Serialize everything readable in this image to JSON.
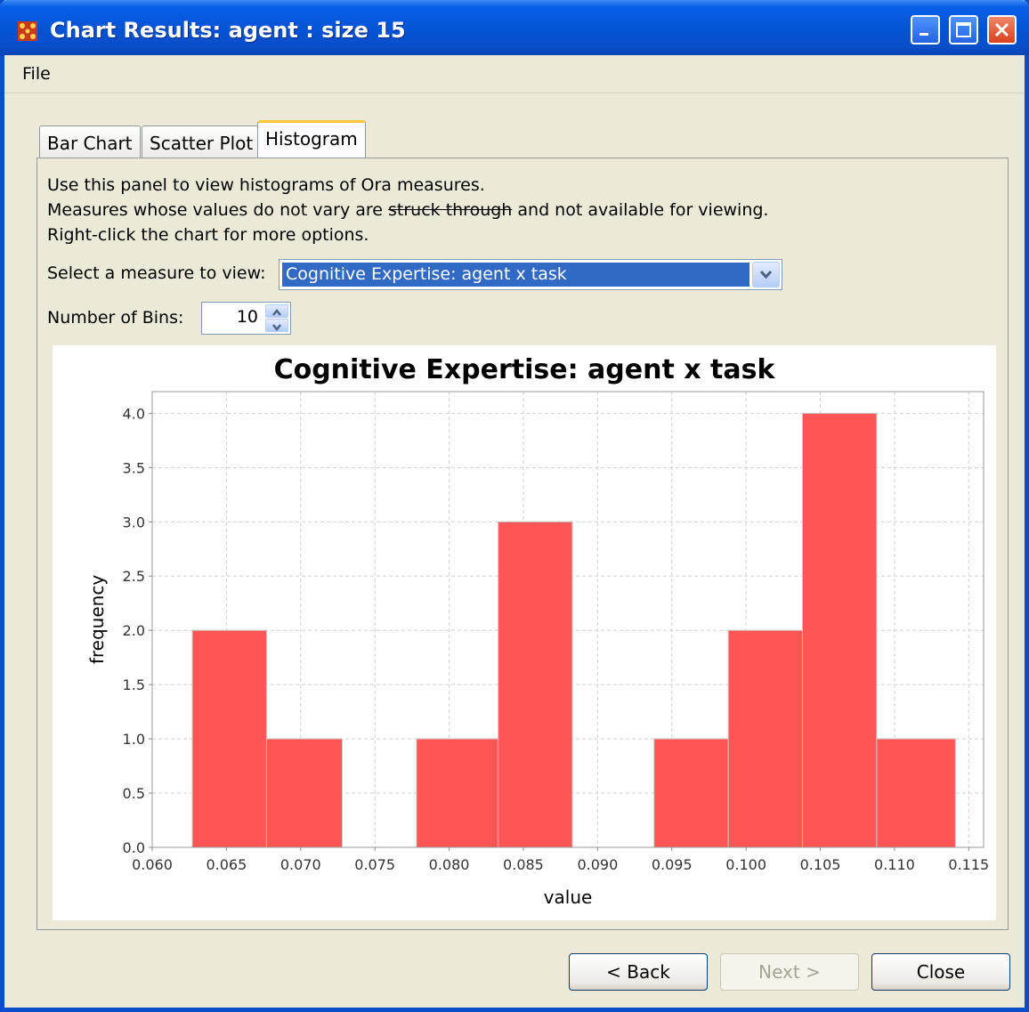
{
  "window": {
    "title": "Chart Results: agent : size 15",
    "menu_file": "File"
  },
  "tabs": [
    "Bar Chart",
    "Scatter Plot",
    "Histogram"
  ],
  "active_tab": "Histogram",
  "panel": {
    "line1": "Use this panel to view histograms of Ora measures.",
    "line2_pre": "Measures whose values do not vary are ",
    "line2_strike": "struck through",
    "line2_post": " and not available for viewing.",
    "line3": "Right-click the chart for more options.",
    "select_label": "Select a measure to view:",
    "select_value": "Cognitive Expertise: agent x task",
    "bins_label": "Number of Bins:",
    "bins_value": "10"
  },
  "buttons": {
    "back": "< Back",
    "next": "Next >",
    "close": "Close"
  },
  "colors": {
    "bar": "#ff5555",
    "accent": "#316ac5"
  },
  "chart_data": {
    "type": "bar",
    "title": "Cognitive Expertise: agent x task",
    "xlabel": "value",
    "ylabel": "frequency",
    "xlim": [
      0.06,
      0.116
    ],
    "ylim": [
      0,
      4.2
    ],
    "xticks": [
      "0.060",
      "0.065",
      "0.070",
      "0.075",
      "0.080",
      "0.085",
      "0.090",
      "0.095",
      "0.100",
      "0.105",
      "0.110",
      "0.115"
    ],
    "yticks": [
      "0.0",
      "0.5",
      "1.0",
      "1.5",
      "2.0",
      "2.5",
      "3.0",
      "3.5",
      "4.0"
    ],
    "grid": true,
    "bins": [
      {
        "start": 0.0627,
        "end": 0.0677,
        "value": 2
      },
      {
        "start": 0.0677,
        "end": 0.0728,
        "value": 1
      },
      {
        "start": 0.0728,
        "end": 0.0778,
        "value": 0
      },
      {
        "start": 0.0778,
        "end": 0.0833,
        "value": 1
      },
      {
        "start": 0.0833,
        "end": 0.0883,
        "value": 3
      },
      {
        "start": 0.0883,
        "end": 0.0938,
        "value": 0
      },
      {
        "start": 0.0938,
        "end": 0.0988,
        "value": 1
      },
      {
        "start": 0.0988,
        "end": 0.1038,
        "value": 2
      },
      {
        "start": 0.1038,
        "end": 0.1088,
        "value": 4
      },
      {
        "start": 0.1088,
        "end": 0.1141,
        "value": 1
      }
    ]
  }
}
